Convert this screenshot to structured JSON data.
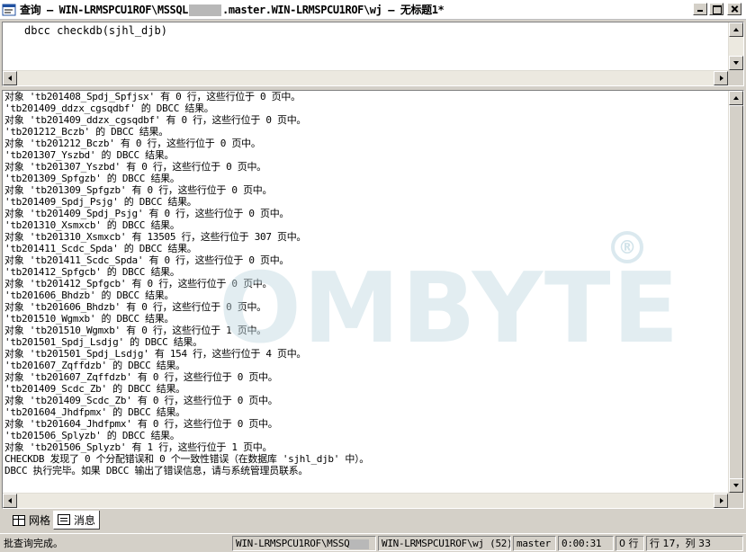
{
  "window": {
    "title_prefix": "查询 — WIN-LRMSPCU1ROF\\MSSQL",
    "title_suffix": ".master.WIN-LRMSPCU1ROF\\wj — 无标题1*"
  },
  "editor": {
    "query_text": "dbcc checkdb(sjhl_djb)"
  },
  "watermark": {
    "text": "OMBYTE",
    "mark": "®"
  },
  "messages": [
    "对象 'tb201408_Spdj_Spfjsx' 有 0 行，这些行位于 0 页中。",
    "'tb201409_ddzx_cgsqdbf' 的 DBCC 结果。",
    "对象 'tb201409_ddzx_cgsqdbf' 有 0 行，这些行位于 0 页中。",
    "'tb201212_Bczb' 的 DBCC 结果。",
    "对象 'tb201212_Bczb' 有 0 行，这些行位于 0 页中。",
    "'tb201307_Yszbd' 的 DBCC 结果。",
    "对象 'tb201307_Yszbd' 有 0 行，这些行位于 0 页中。",
    "'tb201309_Spfgzb' 的 DBCC 结果。",
    "对象 'tb201309_Spfgzb' 有 0 行，这些行位于 0 页中。",
    "'tb201409_Spdj_Psjg' 的 DBCC 结果。",
    "对象 'tb201409_Spdj_Psjg' 有 0 行，这些行位于 0 页中。",
    "'tb201310_Xsmxcb' 的 DBCC 结果。",
    "对象 'tb201310_Xsmxcb' 有 13505 行，这些行位于 307 页中。",
    "'tb201411_Scdc_Spda' 的 DBCC 结果。",
    "对象 'tb201411_Scdc_Spda' 有 0 行，这些行位于 0 页中。",
    "'tb201412_Spfgcb' 的 DBCC 结果。",
    "对象 'tb201412_Spfgcb' 有 0 行，这些行位于 0 页中。",
    "'tb201606_Bhdzb' 的 DBCC 结果。",
    "对象 'tb201606_Bhdzb' 有 0 行，这些行位于 0 页中。",
    "'tb201510_Wgmxb' 的 DBCC 结果。",
    "对象 'tb201510_Wgmxb' 有 0 行，这些行位于 1 页中。",
    "'tb201501_Spdj_Lsdjg' 的 DBCC 结果。",
    "对象 'tb201501_Spdj_Lsdjg' 有 154 行，这些行位于 4 页中。",
    "'tb201607_Zqffdzb' 的 DBCC 结果。",
    "对象 'tb201607_Zqffdzb' 有 0 行，这些行位于 0 页中。",
    "'tb201409_Scdc_Zb' 的 DBCC 结果。",
    "对象 'tb201409_Scdc_Zb' 有 0 行，这些行位于 0 页中。",
    "'tb201604_Jhdfpmx' 的 DBCC 结果。",
    "对象 'tb201604_Jhdfpmx' 有 0 行，这些行位于 0 页中。",
    "'tb201506_Splyzb' 的 DBCC 结果。",
    "对象 'tb201506_Splyzb' 有 1 行，这些行位于 1 页中。",
    "CHECKDB 发现了 0 个分配错误和 0 个一致性错误（在数据库 'sjhl_djb' 中）。",
    "DBCC 执行完毕。如果 DBCC 输出了错误信息，请与系统管理员联系。"
  ],
  "tabs": {
    "grid_label": "网格",
    "messages_label": "消息"
  },
  "status": {
    "message": "批查询完成。",
    "server_prefix": "WIN-LRMSPCU1ROF\\MSSQ",
    "user": "WIN-LRMSPCU1ROF\\wj (52)",
    "database": "master",
    "elapsed": "0:00:31",
    "rows": "0 行",
    "position": "行 17，列 33"
  },
  "icons": {
    "window": "query-window-icon",
    "grid_tab": "grid-icon",
    "messages_tab": "messages-icon"
  }
}
